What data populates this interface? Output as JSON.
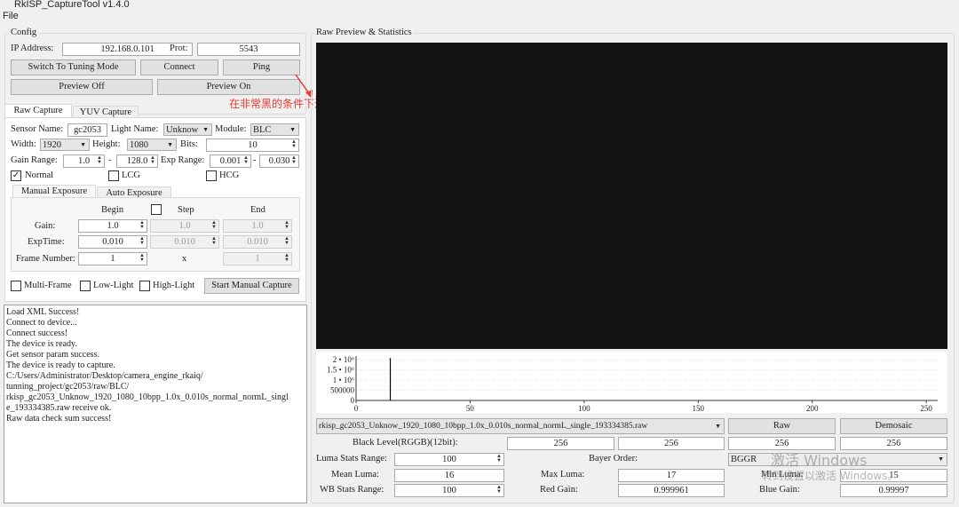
{
  "window": {
    "title": "RkISP_CaptureTool v1.4.0",
    "menu": [
      "File"
    ]
  },
  "config": {
    "title": "Config",
    "ip_label": "IP Address:",
    "ip_value": "192.168.0.101",
    "port_label": "Prot:",
    "port_value": "5543",
    "switch_btn": "Switch To Tuning Mode",
    "connect_btn": "Connect",
    "ping_btn": "Ping",
    "preview_off": "Preview Off",
    "preview_on": "Preview On"
  },
  "annotation": {
    "text": "在非常黑的条件下进行抓拍",
    "color": "#e53935"
  },
  "tabs": [
    "Raw Capture",
    "YUV Capture"
  ],
  "raw": {
    "sensor_label": "Sensor Name:",
    "sensor_value": "gc2053",
    "light_label": "Light Name:",
    "light_value": "Unknow",
    "module_label": "Module:",
    "module_value": "BLC",
    "width_label": "Width:",
    "width_value": "1920",
    "height_label": "Height:",
    "height_value": "1080",
    "bits_label": "Bits:",
    "bits_value": "10",
    "gain_label": "Gain Range:",
    "gain_min": "1.0",
    "gain_max": "128.0",
    "dash": "-",
    "exp_label": "Exp Range:",
    "exp_min": "0.001",
    "exp_max": "0.030",
    "normal": {
      "label": "Normal",
      "checked": true
    },
    "lcg": {
      "label": "LCG",
      "checked": false
    },
    "hcg": {
      "label": "HCG",
      "checked": false
    },
    "subtabs": [
      "Manual Exposure",
      "Auto Exposure"
    ],
    "cols": {
      "begin": "Begin",
      "step": "Step",
      "end": "End"
    },
    "gain_row": {
      "label": "Gain:",
      "begin": "1.0",
      "step": "1.0",
      "end": "1.0"
    },
    "exp_row": {
      "label": "ExpTime:",
      "begin": "0.010",
      "step": "0.010",
      "end": "0.010"
    },
    "frame_row": {
      "label": "Frame Number:",
      "begin": "1",
      "step": "x",
      "end": "1"
    },
    "multi": "Multi-Frame",
    "low": "Low-Light",
    "high": "High-Light",
    "start_btn": "Start Manual Capture"
  },
  "log": [
    "Load XML Success!",
    "Connect to device...",
    "Connect success!",
    "The device is ready.",
    "Get sensor param success.",
    "The device is ready to capture.",
    "C:/Users/Administrator/Desktop/camera_engine_rkaiq/",
    "tunning_project/gc2053/raw/BLC/",
    "rkisp_gc2053_Unknow_1920_1080_10bpp_1.0x_0.010s_normal_normL_singl",
    "e_193334385.raw receive ok.",
    "Raw data check sum success!"
  ],
  "preview": {
    "title": "Raw Preview & Statistics",
    "file": "rkisp_gc2053_Unknow_1920_1080_10bpp_1.0x_0.010s_normal_normL_single_193334385.raw",
    "raw_btn": "Raw",
    "demosaic_btn": "Demosaic",
    "black_label": "Black Level(RGGB)(12bit):",
    "black": [
      "256",
      "256",
      "256",
      "256"
    ],
    "luma_range_label": "Luma Stats Range:",
    "luma_range": "100",
    "bayer_label": "Bayer Order:",
    "bayer": "BGGR",
    "mean_label": "Mean Luma:",
    "mean": "16",
    "max_label": "Max Luma:",
    "max": "17",
    "min_label": "Min Luma:",
    "min": "15",
    "wb_label": "WB Stats Range:",
    "wb": "100",
    "red_label": "Red Gain:",
    "red": "0.999961",
    "blue_label": "Blue Gain:",
    "blue": "0.99997"
  },
  "watermark": {
    "line1": "激活 Windows",
    "line2": "转到设置以激活 Windows。"
  },
  "chart_data": {
    "type": "bar",
    "xlim": [
      0,
      255
    ],
    "ylim": [
      0,
      2000000
    ],
    "x_ticks": [
      "0",
      "50",
      "100",
      "150",
      "200",
      "250"
    ],
    "y_ticks": [
      "0",
      "500000",
      "1 • 10⁶",
      "1.5 • 10⁶",
      "2 • 10⁶"
    ],
    "bars": [
      {
        "x": 15,
        "y": 2073600
      }
    ],
    "grid": "dotted"
  }
}
